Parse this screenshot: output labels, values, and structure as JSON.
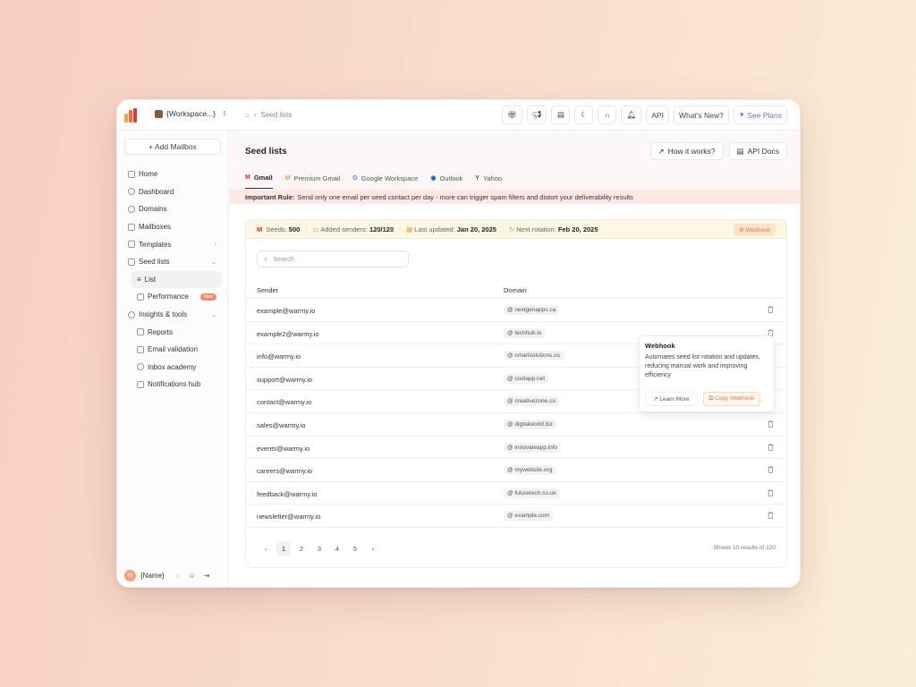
{
  "topbar": {
    "workspace": "{Workspace...}",
    "breadcrumb": "Seed lists",
    "buttons": [
      "API",
      "What's New?",
      "See Plans"
    ]
  },
  "sidebar": {
    "add_mailbox": "+ Add Mailbox",
    "items": [
      {
        "label": "Home"
      },
      {
        "label": "Dashboard"
      },
      {
        "label": "Domains"
      },
      {
        "label": "Mailboxes"
      },
      {
        "label": "Templates"
      },
      {
        "label": "Seed lists"
      },
      {
        "label": "List"
      },
      {
        "label": "Performance",
        "badge": "New"
      },
      {
        "label": "Insights & tools"
      },
      {
        "label": "Reports"
      },
      {
        "label": "Email validation"
      },
      {
        "label": "Inbox  academy"
      },
      {
        "label": "Notifications hub"
      }
    ],
    "user_name": "{Name}",
    "user_initial": "W"
  },
  "main": {
    "title": "Seed lists",
    "how_it_works": "How it works?",
    "api_docs": "API Docs",
    "tabs": [
      "Gmail",
      "Premium Gmail",
      "Google Workspace",
      "Outlook",
      "Yahoo"
    ],
    "rule_label": "Important Rule:",
    "rule_text": "Send only one email per seed contact per day - more can trigger spam filters and distort your deliverability results"
  },
  "stats": {
    "seeds_label": "Seeds:",
    "seeds": "500",
    "added_label": "Added senders:",
    "added": "120/120",
    "updated_label": "Last updated:",
    "updated": "Jan 20, 2025",
    "rotation_label": "Next rotation:",
    "rotation": "Feb 20, 2025",
    "webhook": "Webhook"
  },
  "search": {
    "placeholder": "Search"
  },
  "table": {
    "headers": [
      "Sender",
      "Domain"
    ],
    "rows": [
      {
        "sender": "example@warmy.io",
        "domain": "nextgenapps.ca"
      },
      {
        "sender": "example2@warmy.io",
        "domain": "techhub.io"
      },
      {
        "sender": "info@warmy.io",
        "domain": "smartsolutions.us"
      },
      {
        "sender": "support@warmy.io",
        "domain": "coolapp.net"
      },
      {
        "sender": "contact@warmy.io",
        "domain": "creativezone.co"
      },
      {
        "sender": "sales@warmy.io",
        "domain": "digitalworld.biz"
      },
      {
        "sender": "events@warmy.io",
        "domain": "innovateapp.info"
      },
      {
        "sender": "careers@warmy.io",
        "domain": "mywebsite.org"
      },
      {
        "sender": "feedback@warmy.io",
        "domain": "futuretech.co.uk"
      },
      {
        "sender": "newsletter@warmy.io",
        "domain": "example.com"
      }
    ]
  },
  "pagination": {
    "pages": [
      "1",
      "2",
      "3",
      "4",
      "5"
    ],
    "current": "1",
    "summary": "Shows 10 results of 120"
  },
  "tooltip": {
    "title": "Webhook",
    "text": "Automates seed list rotation and updates, reducing manual work and improving efficiency",
    "learn_more": "Learn More",
    "copy": "Copy Webhook"
  },
  "colors": {
    "accent": "#e07a35",
    "brand_purple": "#8b5cf6",
    "rule_bg": "#fde8e3"
  }
}
